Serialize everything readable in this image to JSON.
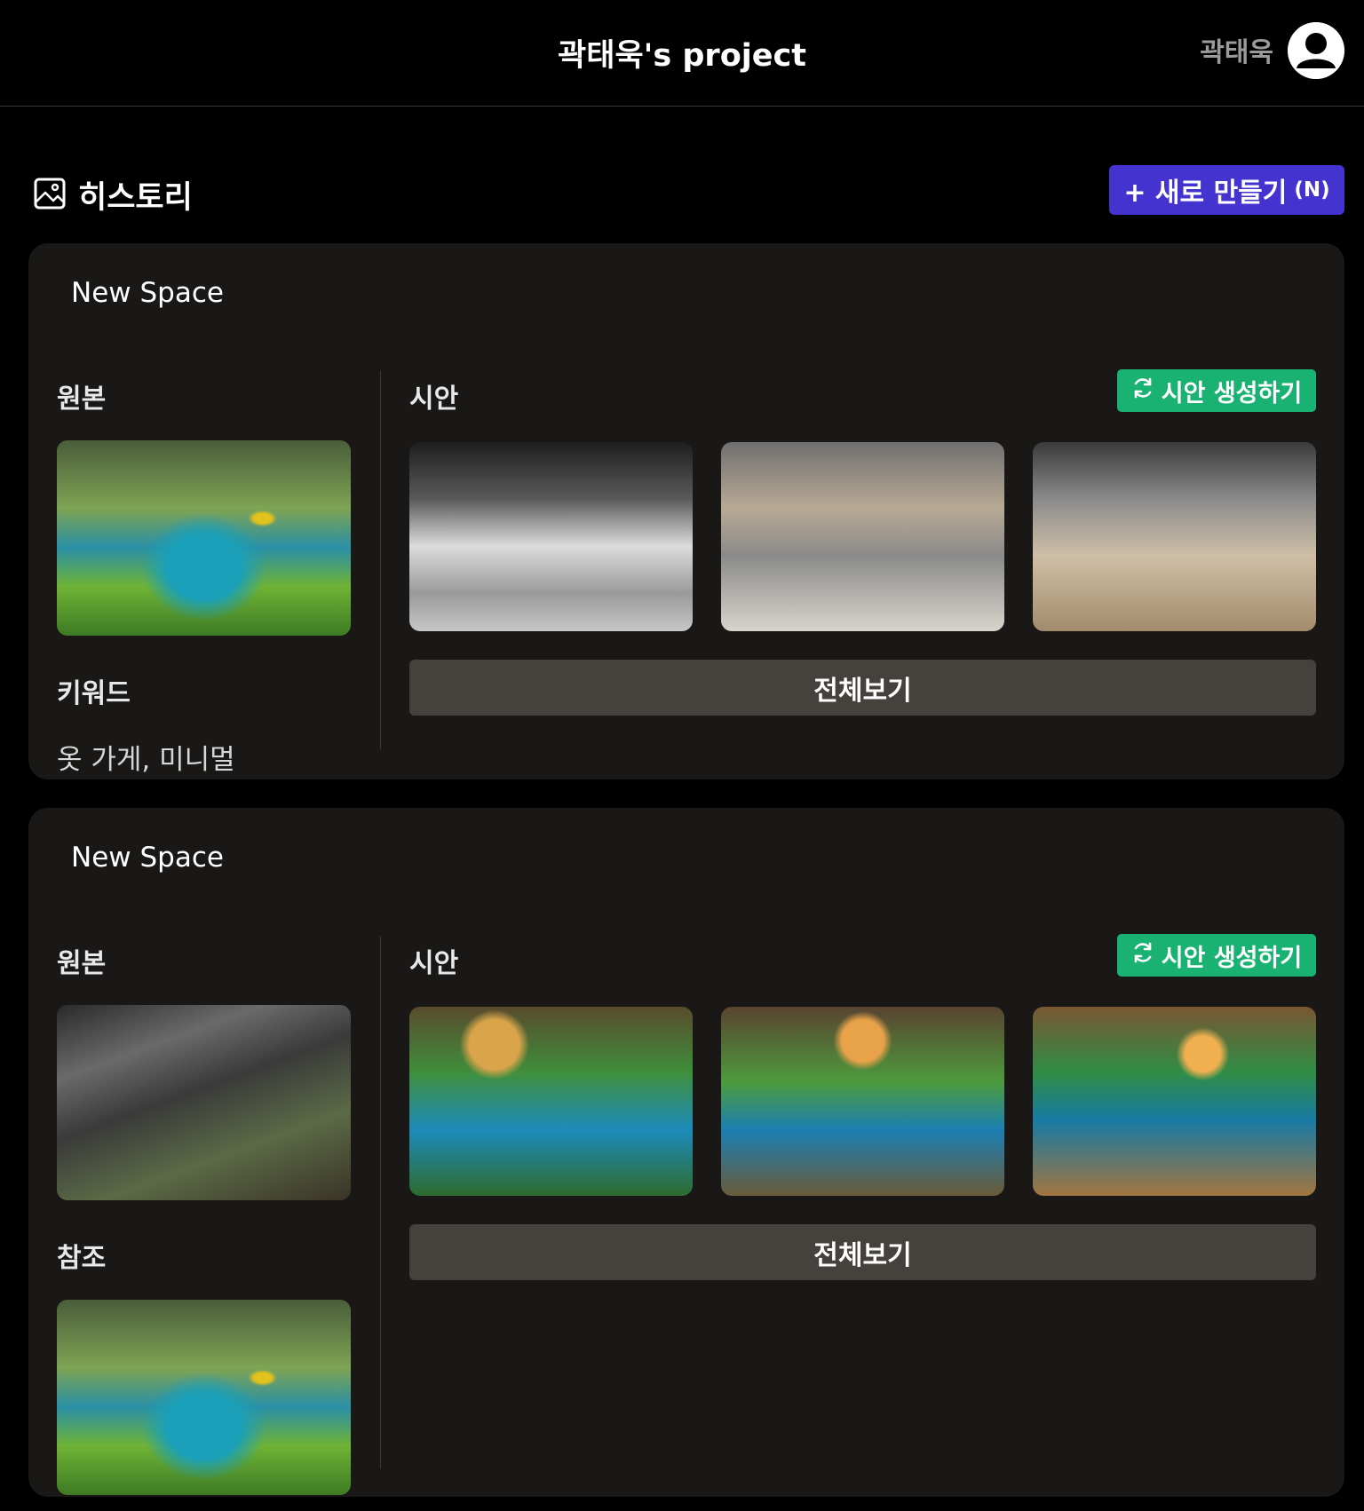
{
  "header": {
    "title": "곽태욱's project",
    "user_name": "곽태욱"
  },
  "history": {
    "title": "히스토리",
    "new_button": "+ 새로 만들기",
    "new_button_shortcut": "(N)"
  },
  "cards": [
    {
      "name": "New Space",
      "original_label": "원본",
      "keyword_label": "키워드",
      "keywords": "옷 가게, 미니멀",
      "draft_label": "시안",
      "generate_button": "시안 생성하기",
      "view_all_button": "전체보기"
    },
    {
      "name": "New Space",
      "original_label": "원본",
      "reference_label": "참조",
      "draft_label": "시안",
      "generate_button": "시안 생성하기",
      "view_all_button": "전체보기"
    }
  ],
  "icons": {
    "history": "image-icon",
    "generate": "refresh-icon",
    "avatar": "user-avatar-icon"
  },
  "colors": {
    "accent": "#4433cf",
    "generate": "#1ab273",
    "card_bg": "#191817",
    "view_all_bg": "#45423d"
  }
}
